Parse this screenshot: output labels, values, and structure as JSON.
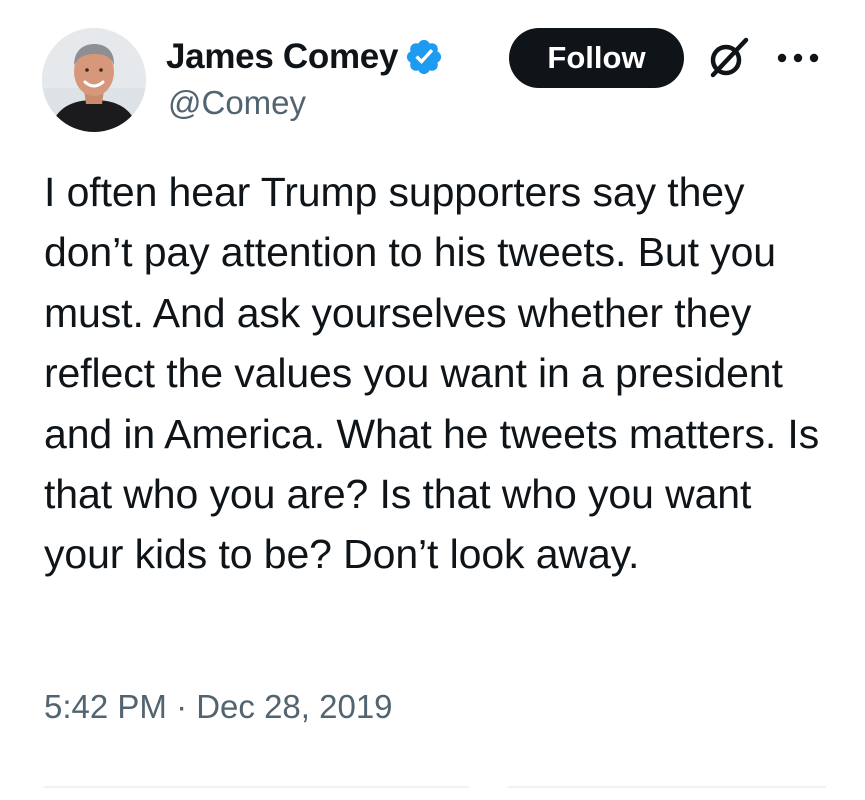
{
  "tweet": {
    "author": {
      "display_name": "James Comey",
      "handle": "@Comey",
      "verified": true,
      "avatar_icon": "profile-photo"
    },
    "follow_label": "Follow",
    "icons": {
      "grok": "grok-icon",
      "more": "more-options-icon",
      "verified": "verified-badge-icon"
    },
    "text": "I often hear Trump supporters say they don’t pay attention to his tweets. But you must. And ask yourselves whether they reflect the values you want in a president and in America. What he tweets matters. Is that who you are? Is that who you want your kids to be? Don’t look away.",
    "timestamp": "5:42 PM · Dec 28, 2019"
  },
  "colors": {
    "text_primary": "#0f1419",
    "text_secondary": "#536471",
    "verified_blue": "#1d9bf0",
    "follow_bg": "#0f1419",
    "follow_text": "#ffffff"
  }
}
